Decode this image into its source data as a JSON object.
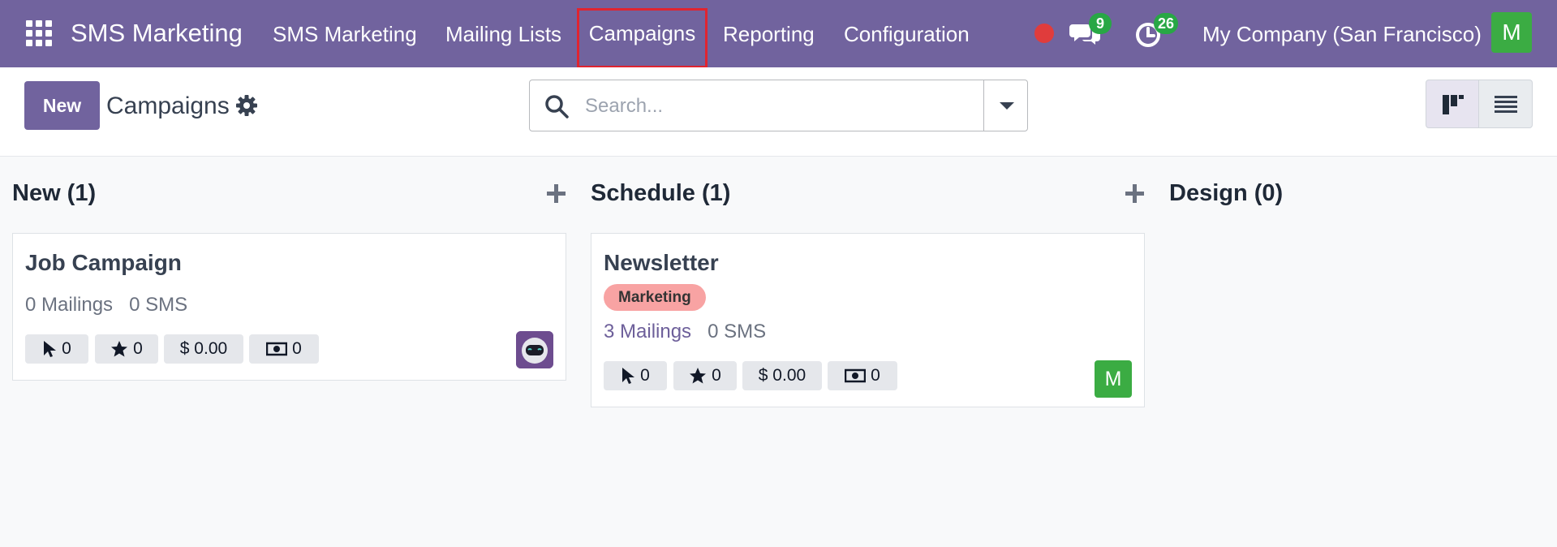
{
  "navbar": {
    "app_name": "SMS Marketing",
    "menus": [
      "SMS Marketing",
      "Mailing Lists",
      "Campaigns",
      "Reporting",
      "Configuration"
    ],
    "active_menu": "Campaigns",
    "messages_count": "9",
    "activities_count": "26",
    "company": "My Company (San Francisco)",
    "user_initial": "M",
    "colors": {
      "bar": "#71639e",
      "badge": "#28a745",
      "highlight": "#e02430"
    }
  },
  "control_panel": {
    "new_label": "New",
    "title": "Campaigns",
    "search_placeholder": "Search...",
    "views": [
      "kanban",
      "list"
    ],
    "active_view": "kanban"
  },
  "kanban": {
    "columns": [
      {
        "name": "New (1)",
        "cards": [
          {
            "title": "Job Campaign",
            "mailings": "0 Mailings",
            "sms": "0 SMS",
            "clicks": "0",
            "favorites": "0",
            "revenue": "$ 0.00",
            "cost": "0",
            "avatar": "robot-avatar"
          }
        ]
      },
      {
        "name": "Schedule (1)",
        "cards": [
          {
            "title": "Newsletter",
            "tag": "Marketing",
            "mailings": "3 Mailings",
            "sms": "0 SMS",
            "clicks": "0",
            "favorites": "0",
            "revenue": "$ 0.00",
            "cost": "0",
            "avatar_initial": "M"
          }
        ]
      },
      {
        "name": "Design (0)",
        "cards": []
      }
    ]
  }
}
